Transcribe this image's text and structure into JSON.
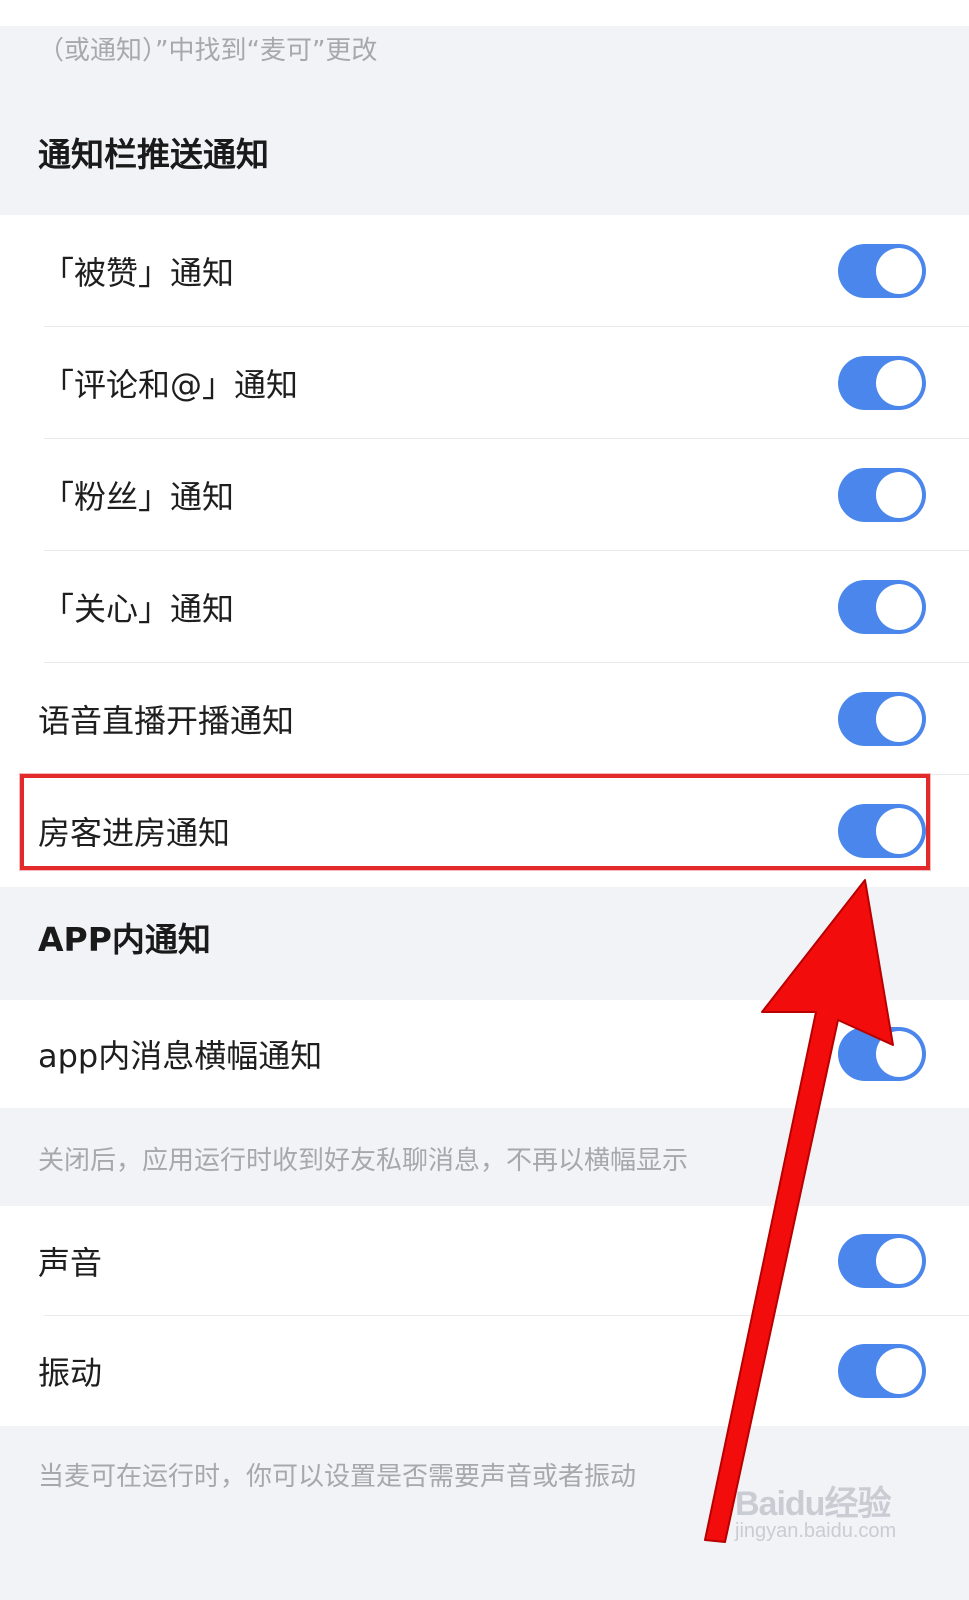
{
  "top_hint": "（或通知）”中找到“麦可”更改",
  "sections": {
    "push": {
      "title": "通知栏推送通知",
      "items": [
        {
          "label": "「被赞」通知",
          "enabled": true
        },
        {
          "label": "「评论和@」通知",
          "enabled": true
        },
        {
          "label": "「粉丝」通知",
          "enabled": true
        },
        {
          "label": "「关心」通知",
          "enabled": true
        },
        {
          "label": "语音直播开播通知",
          "enabled": true
        },
        {
          "label": "房客进房通知",
          "enabled": true
        }
      ]
    },
    "inapp": {
      "title": "APP内通知",
      "items": [
        {
          "label": "app内消息横幅通知",
          "enabled": true
        }
      ],
      "hint": "关闭后，应用运行时收到好友私聊消息，不再以横幅显示"
    },
    "sound": {
      "items": [
        {
          "label": "声音",
          "enabled": true
        },
        {
          "label": "振动",
          "enabled": true
        }
      ],
      "hint": "当麦可在运行时，你可以设置是否需要声音或者振动"
    }
  },
  "annotation": {
    "highlight_color": "#e22a2a",
    "arrow_color": "#f20c0c"
  },
  "watermark": {
    "main": "Baidu经验",
    "sub": "jingyan.baidu.com"
  },
  "colors": {
    "toggle_on": "#4a86ec",
    "background": "#f2f3f7"
  }
}
